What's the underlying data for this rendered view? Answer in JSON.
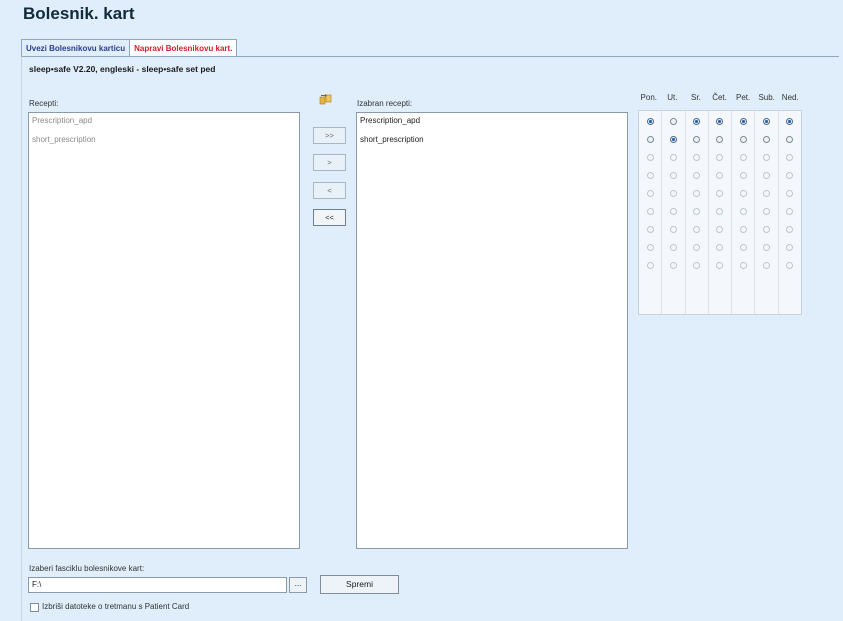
{
  "page_title": "Bolesnik. kart",
  "tabs": [
    {
      "label": "Uvezi Bolesnikovu karticu",
      "active": false
    },
    {
      "label": "Napravi Bolesnikovu kart.",
      "active": true
    }
  ],
  "set_title": "sleep•safe V2.20, engleski - sleep•safe set ped",
  "available": {
    "label": "Recepti:",
    "items": [
      "Prescription_apd",
      "short_prescription"
    ]
  },
  "selected": {
    "label": "Izabran recepti:",
    "items": [
      "Prescription_apd",
      "short_prescription"
    ]
  },
  "move_buttons": {
    "add_all": ">>",
    "add_one": ">",
    "remove_one": "<",
    "remove_all": "<<"
  },
  "swap_icon": "swap-icon",
  "days": [
    "Pon.",
    "Ut.",
    "Sr.",
    "Čet.",
    "Pet.",
    "Sub.",
    "Ned."
  ],
  "schedule": [
    {
      "selected_day_index": [
        0,
        2,
        3,
        4,
        5,
        6
      ],
      "row": 1
    },
    {
      "selected_day_index": [
        1
      ],
      "row": 2
    }
  ],
  "folder": {
    "label": "Izaberi fasciklu bolesnikove kart:",
    "value": "F:\\",
    "browse_label": "..."
  },
  "save_label": "Spremi",
  "delete_checkbox": {
    "label": "Izbriši datoteke o tretmanu s Patient Card",
    "checked": false
  }
}
